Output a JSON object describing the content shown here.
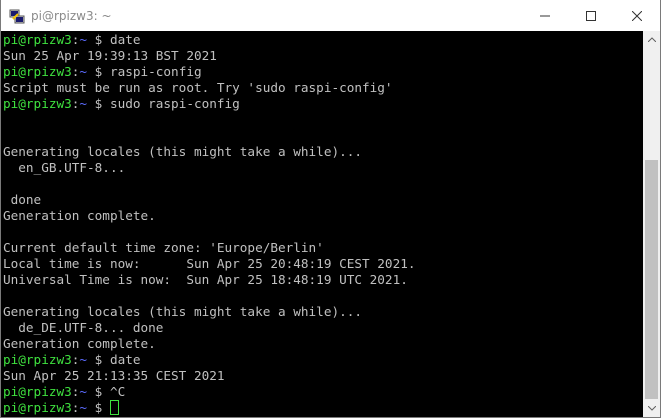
{
  "window": {
    "title": "pi@rpizw3: ~",
    "app_icon": "putty-icon",
    "controls": [
      "minimize-icon",
      "maximize-icon",
      "close-icon"
    ]
  },
  "colors": {
    "background": "#000000",
    "text": "#c0c0c0",
    "prompt_user": "#3fe23f",
    "prompt_path": "#5c6cff"
  },
  "prompt": {
    "user": "pi@rpizw3",
    "sep": ":",
    "path": "~",
    "symbol": " $ "
  },
  "terminal": {
    "lines": [
      {
        "prompt": true,
        "cmd": "date"
      },
      {
        "text": "Sun 25 Apr 19:39:13 BST 2021"
      },
      {
        "prompt": true,
        "cmd": "raspi-config"
      },
      {
        "text": "Script must be run as root. Try 'sudo raspi-config'"
      },
      {
        "prompt": true,
        "cmd": "sudo raspi-config"
      },
      {
        "text": ""
      },
      {
        "text": ""
      },
      {
        "text": "Generating locales (this might take a while)..."
      },
      {
        "text": "  en_GB.UTF-8..."
      },
      {
        "text": ""
      },
      {
        "text": " done"
      },
      {
        "text": "Generation complete."
      },
      {
        "text": ""
      },
      {
        "text": "Current default time zone: 'Europe/Berlin'"
      },
      {
        "text": "Local time is now:      Sun Apr 25 20:48:19 CEST 2021."
      },
      {
        "text": "Universal Time is now:  Sun Apr 25 18:48:19 UTC 2021."
      },
      {
        "text": ""
      },
      {
        "text": "Generating locales (this might take a while)..."
      },
      {
        "text": "  de_DE.UTF-8... done"
      },
      {
        "text": "Generation complete."
      },
      {
        "prompt": true,
        "cmd": "date"
      },
      {
        "text": "Sun Apr 25 21:13:35 CEST 2021"
      },
      {
        "prompt": true,
        "cmd": "^C"
      },
      {
        "prompt": true,
        "cmd": "",
        "cursor": true
      }
    ]
  }
}
